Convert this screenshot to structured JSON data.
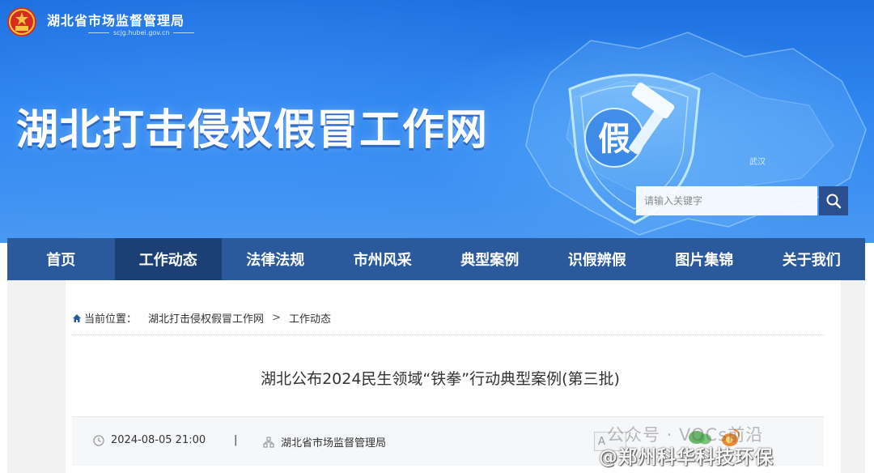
{
  "header": {
    "org_name": "湖北省市场监督管理局",
    "org_domain": "scjg.hubei.gov.cn",
    "site_title": "湖北打击侵权假冒工作网",
    "shield_char": "假",
    "city_label": "武汉",
    "search_placeholder": "请输入关键字",
    "search_icon": "search-icon"
  },
  "nav": {
    "items": [
      {
        "label": "首页",
        "active": false
      },
      {
        "label": "工作动态",
        "active": true
      },
      {
        "label": "法律法规",
        "active": false
      },
      {
        "label": "市州风采",
        "active": false
      },
      {
        "label": "典型案例",
        "active": false
      },
      {
        "label": "识假辨假",
        "active": false
      },
      {
        "label": "图片集锦",
        "active": false
      },
      {
        "label": "关于我们",
        "active": false
      }
    ]
  },
  "breadcrumb": {
    "prefix": "当前位置：",
    "items": [
      "湖北打击侵权假冒工作网",
      "工作动态"
    ],
    "separator": ">"
  },
  "article": {
    "title": "湖北公布2024民生领域“铁拳”行动典型案例(第三批)",
    "date": "2024-08-05 21:00",
    "divider": "|",
    "source": "湖北省市场监督管理局"
  },
  "watermark": {
    "line1": "公众号 · VOCs前沿",
    "line2": "@郑州科华科技环保",
    "font_btn": "A"
  },
  "colors": {
    "header_blue": "#2f86f0",
    "nav_bg": "#2a5a9c",
    "nav_active": "#1c3f75",
    "search_btn": "#2b4f8e"
  }
}
